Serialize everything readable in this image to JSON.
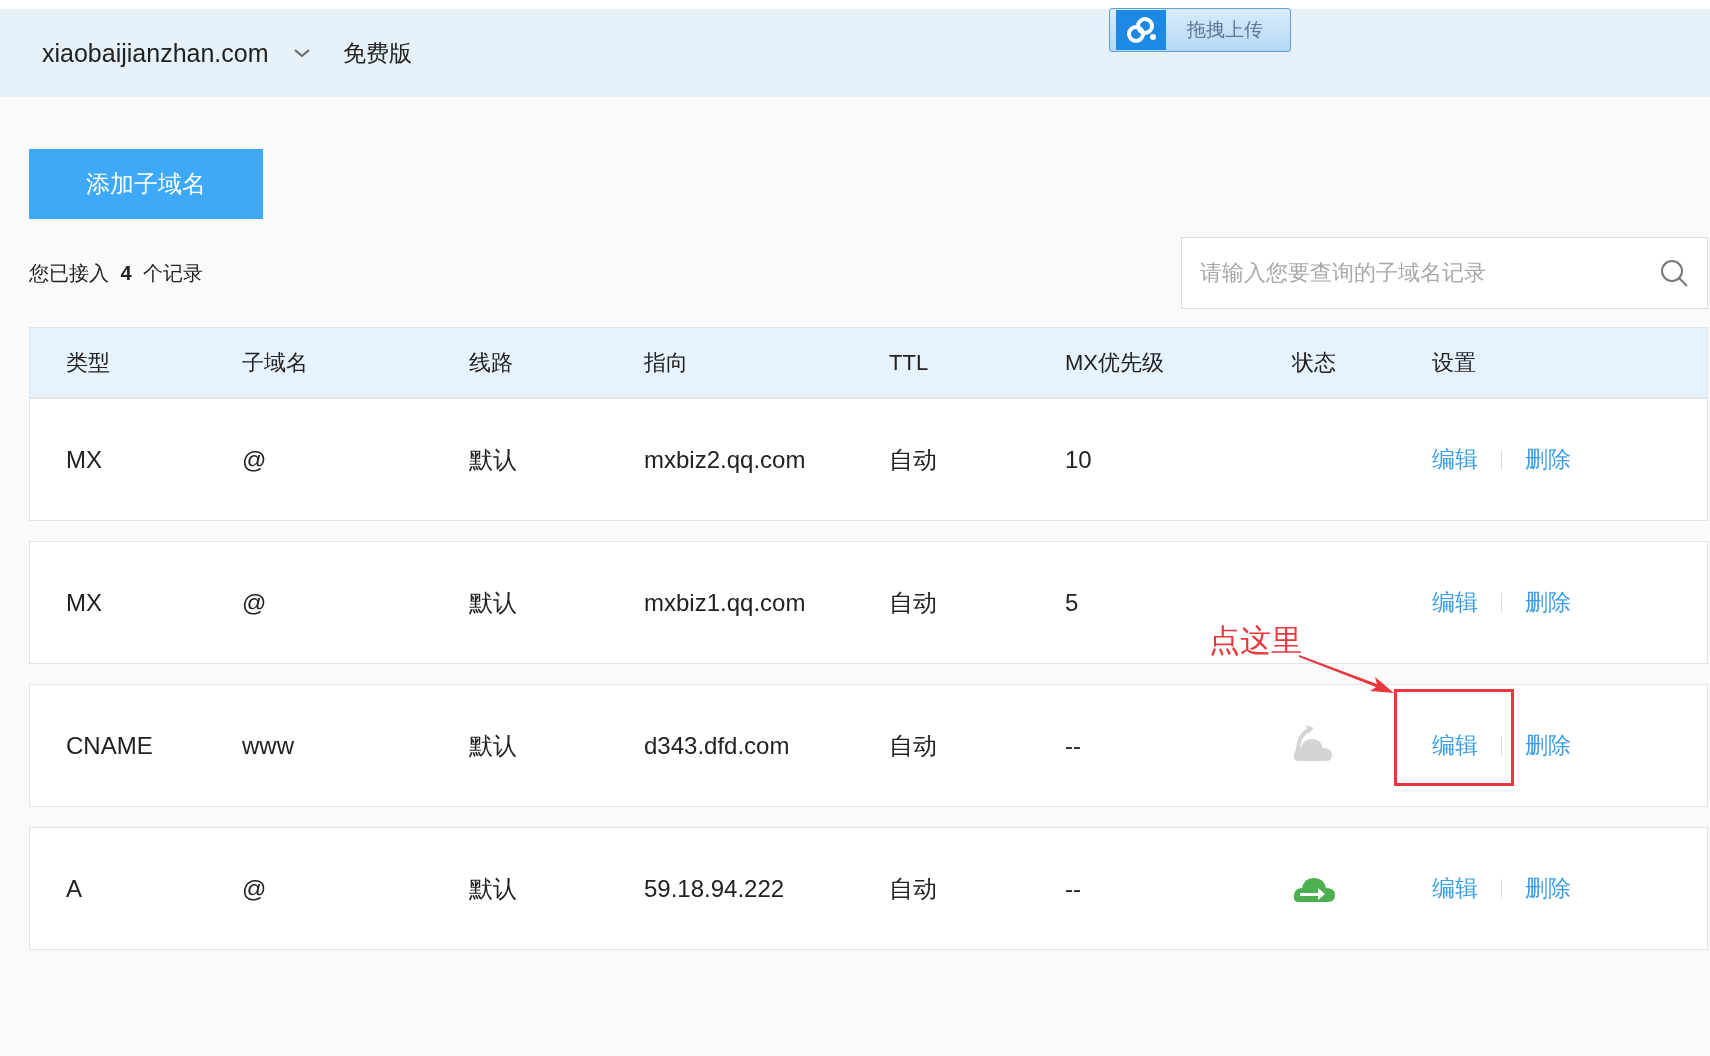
{
  "topbar": {
    "domain": "xiaobaijianzhan.com",
    "plan": "免费版",
    "upload_button": "拖拽上传"
  },
  "add_button": "添加子域名",
  "record_count": {
    "prefix": "您已接入",
    "count": "4",
    "suffix": "个记录"
  },
  "search": {
    "placeholder": "请输入您要查询的子域名记录"
  },
  "table": {
    "columns": [
      "类型",
      "子域名",
      "线路",
      "指向",
      "TTL",
      "MX优先级",
      "状态",
      "设置"
    ],
    "rows": [
      {
        "type": "MX",
        "subdomain": "@",
        "line": "默认",
        "target": "mxbiz2.qq.com",
        "ttl": "自动",
        "mx_priority": "10",
        "kind": "none",
        "edit": "编辑",
        "delete": "删除",
        "highlighted": false
      },
      {
        "type": "MX",
        "subdomain": "@",
        "line": "默认",
        "target": "mxbiz1.qq.com",
        "ttl": "自动",
        "mx_priority": "5",
        "kind": "none",
        "edit": "编辑",
        "delete": "删除",
        "highlighted": false
      },
      {
        "type": "CNAME",
        "subdomain": "www",
        "line": "默认",
        "target": "d343.dfd.com",
        "ttl": "自动",
        "mx_priority": "--",
        "kind": "paused",
        "edit": "编辑",
        "delete": "删除",
        "highlighted": true
      },
      {
        "type": "A",
        "subdomain": "@",
        "line": "默认",
        "target": "59.18.94.222",
        "ttl": "自动",
        "mx_priority": "--",
        "kind": "active",
        "edit": "编辑",
        "delete": "删除",
        "highlighted": false
      }
    ]
  },
  "annotation": {
    "text": "点这里"
  }
}
